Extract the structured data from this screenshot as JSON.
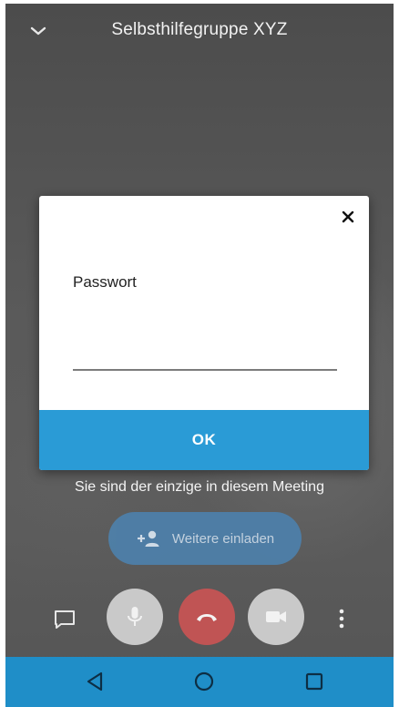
{
  "header": {
    "title": "Selbsthilfegruppe XYZ",
    "collapse_icon": "chevron-down-icon"
  },
  "dialog": {
    "close_icon": "close-icon",
    "password_label": "Passwort",
    "password_value": "",
    "ok_label": "OK"
  },
  "meeting": {
    "status_text": "Sie sind der einzige in diesem Meeting",
    "invite_label": "Weitere einladen",
    "invite_icon": "add-person-icon"
  },
  "controls": {
    "chat_icon": "chat-icon",
    "mic_icon": "microphone-icon",
    "hangup_icon": "hang-up-icon",
    "video_icon": "video-camera-icon",
    "more_icon": "more-vertical-icon"
  },
  "navbar": {
    "back_icon": "back-icon",
    "home_icon": "home-icon",
    "recents_icon": "recents-icon"
  },
  "colors": {
    "accent": "#2a9bd6",
    "navbar": "#1f8ec8",
    "invite_pill": "#4e7fa9",
    "hangup": "#c05454",
    "control_grey": "#c9c9c9"
  }
}
